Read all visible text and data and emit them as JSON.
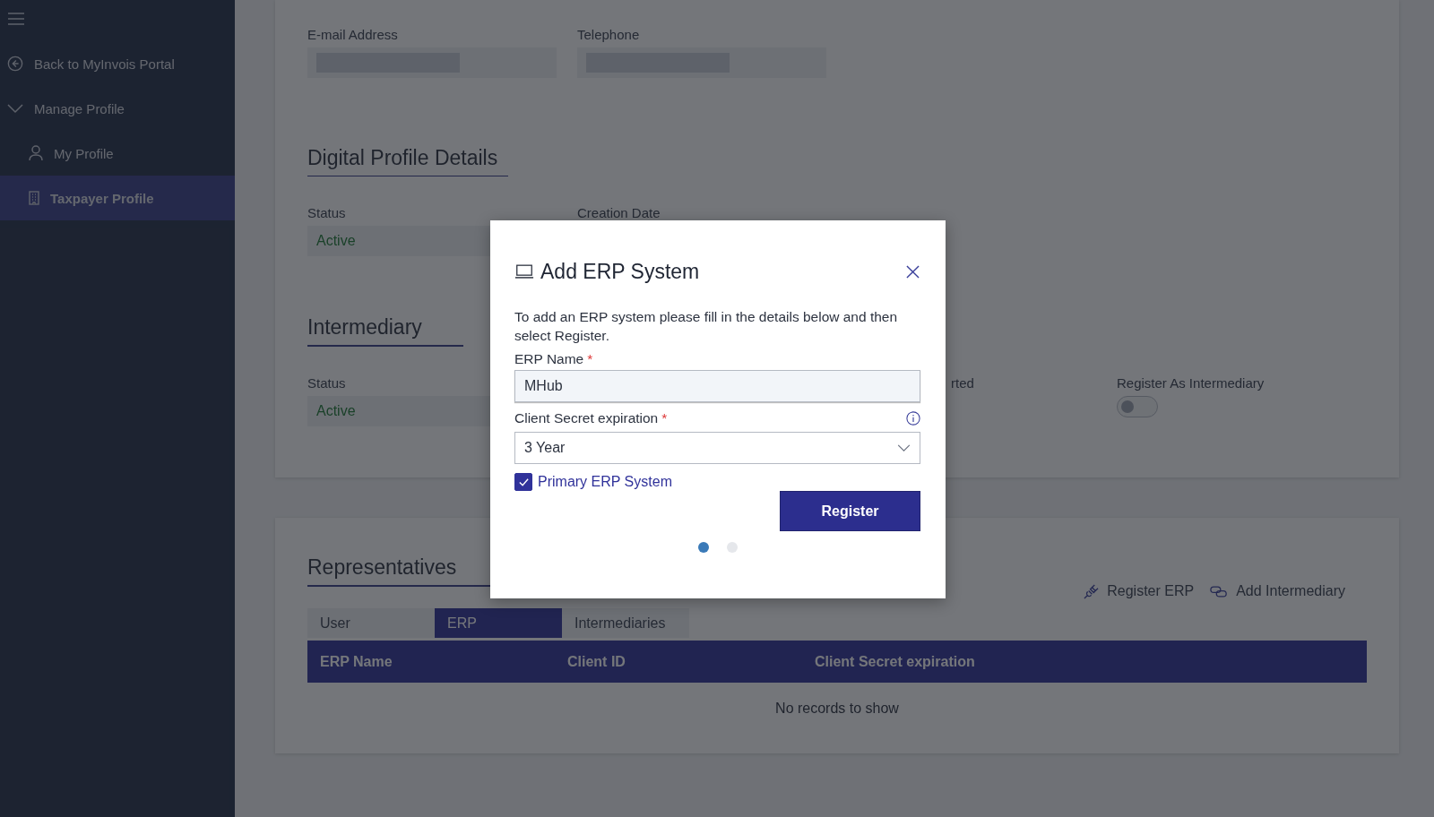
{
  "sidebar": {
    "back_link": "Back to MyInvois Portal",
    "group": {
      "label": "Manage Profile",
      "expanded": true,
      "children": [
        {
          "kind": "person",
          "label": "My Profile",
          "selected": false
        },
        {
          "kind": "building",
          "label": "Taxpayer Profile",
          "selected": true
        }
      ]
    }
  },
  "contact": {
    "fields": [
      {
        "label": "E-mail Address"
      },
      {
        "label": "Telephone"
      }
    ]
  },
  "digital_profile": {
    "title": "Digital Profile Details",
    "fields": [
      {
        "label": "Status",
        "value": "Active"
      },
      {
        "label": "Creation Date"
      }
    ]
  },
  "intermediary": {
    "title": "Intermediary",
    "fields": [
      {
        "label": "Status",
        "value": "Active"
      },
      {
        "label": "rted"
      }
    ],
    "toggle": {
      "label": "Register As Intermediary",
      "on": false
    }
  },
  "representatives": {
    "title": "Representatives",
    "actions": [
      {
        "kind": "plug",
        "label": "Register ERP"
      },
      {
        "kind": "link",
        "label": "Add Intermediary"
      }
    ],
    "tabs": [
      {
        "label": "User",
        "selected": false
      },
      {
        "label": "ERP",
        "selected": true
      },
      {
        "label": "Intermediaries",
        "selected": false
      }
    ],
    "table": {
      "columns": [
        "ERP Name",
        "Client ID",
        "Client Secret expiration"
      ],
      "empty_text": "No records to show"
    }
  },
  "modal": {
    "title": "Add ERP System",
    "description": "To add an ERP system please fill in the details below and then select Register.",
    "erp_name": {
      "label": "ERP Name",
      "required_mark": "*",
      "value": "MHub"
    },
    "expiration": {
      "label": "Client Secret expiration",
      "required_mark": "*",
      "value": "3 Year"
    },
    "primary": {
      "label": "Primary ERP System",
      "checked": true
    },
    "button": "Register",
    "pager": [
      {
        "selected": true
      },
      {
        "selected": false
      }
    ]
  }
}
